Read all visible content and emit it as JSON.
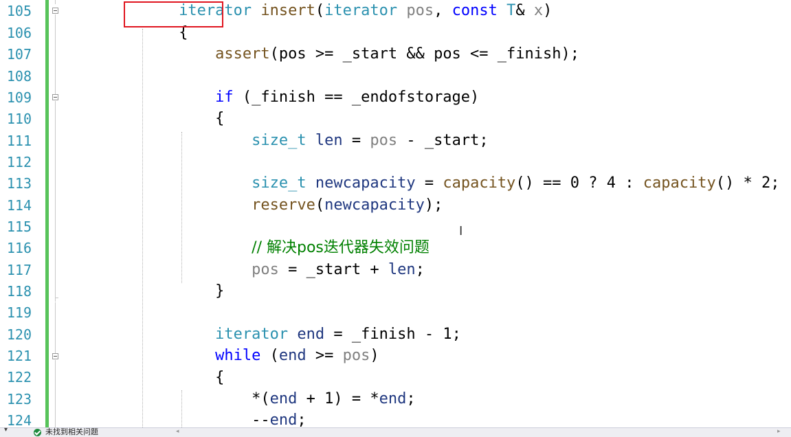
{
  "editor": {
    "line_numbers": [
      "105",
      "106",
      "107",
      "108",
      "109",
      "110",
      "111",
      "112",
      "113",
      "114",
      "115",
      "116",
      "117",
      "118",
      "119",
      "120",
      "121",
      "122",
      "123",
      "124"
    ],
    "lines": {
      "l105": {
        "kw1": "iterator",
        "fn": "insert",
        "p1": "(",
        "ty1": "iterator",
        "sp1": " ",
        "prm1": "pos",
        "p2": ", ",
        "kw2": "const",
        "sp2": " ",
        "ty2": "T",
        "p3": "& ",
        "prm2": "x",
        "p4": ")"
      },
      "l106": {
        "p1": "{"
      },
      "l107": {
        "fn": "assert",
        "p1": "(pos >= _start && pos <= _finish);"
      },
      "l109": {
        "kw": "if",
        "p1": " (_finish == _endofstorage)"
      },
      "l110": {
        "p1": "{"
      },
      "l111": {
        "ty": "size_t",
        "p1": " ",
        "var": "len",
        "p2": " = ",
        "prm": "pos",
        "p3": " - _start;"
      },
      "l113": {
        "ty": "size_t",
        "p1": " ",
        "var": "newcapacity",
        "p2": " = ",
        "fn1": "capacity",
        "p3": "() == 0 ? 4 : ",
        "fn2": "capacity",
        "p4": "() * 2;"
      },
      "l114": {
        "fn": "reserve",
        "p1": "(",
        "var": "newcapacity",
        "p2": ");"
      },
      "l116": {
        "cm": "// 解决pos迭代器失效问题"
      },
      "l117": {
        "prm": "pos",
        "p1": " = _start + ",
        "var": "len",
        "p2": ";"
      },
      "l118": {
        "p1": "}"
      },
      "l120": {
        "ty": "iterator",
        "p1": " ",
        "var": "end",
        "p2": " = _finish - 1;"
      },
      "l121": {
        "kw": "while",
        "p1": " (",
        "var": "end",
        "p2": " >= ",
        "prm": "pos",
        "p3": ")"
      },
      "l122": {
        "p1": "{"
      },
      "l123": {
        "p1": "*(",
        "var1": "end",
        "p2": " + 1) = *",
        "var2": "end",
        "p3": ";"
      },
      "l124": {
        "p1": "--",
        "var": "end",
        "p2": ";"
      }
    }
  },
  "statusbar": {
    "message": "未找到相关问题",
    "status_icon": "check-circle-icon"
  },
  "colors": {
    "keyword": "#0000ff",
    "type": "#2b91af",
    "function": "#74531f",
    "parameter": "#808080",
    "local": "#1f377f",
    "comment": "#008000",
    "line_number": "#2b91af",
    "change_bar": "#57c35a",
    "highlight_box": "#e0151f"
  }
}
